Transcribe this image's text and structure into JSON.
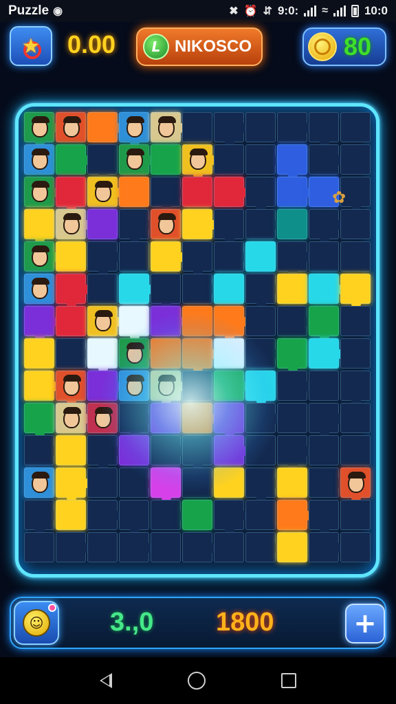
{
  "status_bar": {
    "app_name": "Puzzle",
    "time_left": "9:0:",
    "time_right": "10:0"
  },
  "hud_top": {
    "score": "0.00",
    "title": "NIKOSCO",
    "title_icon_letter": "L",
    "coins": "80"
  },
  "hud_bottom": {
    "stat_left": "3.,0",
    "stat_right": "1800",
    "add_label": "+"
  },
  "board": {
    "columns": 11,
    "rows": 14,
    "palette": {
      "navy": "#13294f",
      "green": "#17a34a",
      "orange": "#ff7a1a",
      "red": "#e0283a",
      "yellow": "#ffd21f",
      "purple": "#7a2fd8",
      "blue": "#2f5fe0",
      "cyan": "#27d8e8",
      "teal": "#0f8f8a",
      "magenta": "#d640e8",
      "white": "#e8f8ff"
    },
    "cells": [
      [
        "portrait",
        "portrait",
        "orange",
        "portrait",
        "portrait",
        "navy",
        "navy",
        "navy",
        "navy",
        "navy",
        "navy"
      ],
      [
        "portrait",
        "green",
        "navy",
        "portrait",
        "green",
        "portrait",
        "navy",
        "navy",
        "blue",
        "navy",
        "navy"
      ],
      [
        "portrait",
        "red",
        "portrait",
        "orange",
        "navy",
        "red",
        "red",
        "navy",
        "blue",
        "blue",
        "navy"
      ],
      [
        "yellow",
        "portrait",
        "purple",
        "navy",
        "portrait",
        "yellow",
        "navy",
        "navy",
        "teal",
        "navy",
        "navy"
      ],
      [
        "portrait",
        "yellow",
        "navy",
        "navy",
        "yellow",
        "navy",
        "navy",
        "cyan",
        "navy",
        "navy",
        "navy"
      ],
      [
        "portrait",
        "red",
        "navy",
        "cyan",
        "navy",
        "navy",
        "cyan",
        "navy",
        "yellow",
        "cyan",
        "yellow"
      ],
      [
        "purple",
        "red",
        "portrait",
        "white",
        "purple",
        "orange",
        "orange",
        "navy",
        "navy",
        "green",
        "navy"
      ],
      [
        "yellow",
        "navy",
        "white",
        "portrait",
        "orange",
        "orange",
        "white",
        "navy",
        "green",
        "cyan",
        "navy"
      ],
      [
        "yellow",
        "portrait",
        "purple",
        "portrait",
        "portrait",
        "navy",
        "green",
        "cyan",
        "navy",
        "navy",
        "navy"
      ],
      [
        "green",
        "portrait",
        "portrait",
        "navy",
        "purple",
        "orange",
        "purple",
        "navy",
        "navy",
        "navy",
        "navy"
      ],
      [
        "navy",
        "yellow",
        "navy",
        "purple",
        "navy",
        "navy",
        "purple",
        "navy",
        "navy",
        "navy",
        "navy"
      ],
      [
        "portrait",
        "yellow",
        "navy",
        "navy",
        "magenta",
        "navy",
        "yellow",
        "navy",
        "yellow",
        "navy",
        "portrait"
      ],
      [
        "navy",
        "yellow",
        "navy",
        "navy",
        "navy",
        "green",
        "navy",
        "navy",
        "orange",
        "navy",
        "navy"
      ],
      [
        "navy",
        "navy",
        "navy",
        "navy",
        "navy",
        "navy",
        "navy",
        "navy",
        "yellow",
        "navy",
        "navy"
      ]
    ]
  },
  "icons": {
    "badge": "star-target-icon",
    "coin": "gold-coin-icon",
    "avatar": "smiley-face-icon",
    "add": "plus-icon"
  }
}
